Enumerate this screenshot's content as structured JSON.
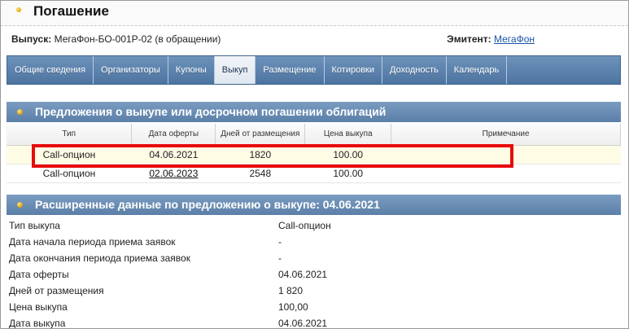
{
  "header": {
    "title": "Погашение"
  },
  "issue": {
    "label": "Выпуск:",
    "name": "МегаФон-БО-001Р-02 (в обращении)",
    "issuer_label": "Эмитент:",
    "issuer_link": "МегаФон"
  },
  "tabs": [
    {
      "label": "Общие сведения"
    },
    {
      "label": "Организаторы"
    },
    {
      "label": "Купоны"
    },
    {
      "label": "Выкуп"
    },
    {
      "label": "Размещение"
    },
    {
      "label": "Котировки"
    },
    {
      "label": "Доходность"
    },
    {
      "label": "Календарь"
    }
  ],
  "active_tab": "Выкуп",
  "offers": {
    "title": "Предложения о выкупе или досрочном погашении облигаций",
    "columns": {
      "type": "Тип",
      "date": "Дата оферты",
      "days": "Дней от размещения",
      "price": "Цена выкупа",
      "note": "Примечание"
    },
    "rows": [
      {
        "type": "Call-опцион",
        "date": "04.06.2021",
        "days": "1820",
        "price": "100.00",
        "note": ""
      },
      {
        "type": "Call-опцион",
        "date": "02.06.2023",
        "days": "2548",
        "price": "100.00",
        "note": ""
      }
    ]
  },
  "details": {
    "title": "Расширенные данные по предложению о выкупе: 04.06.2021",
    "rows": [
      {
        "k": "Тип выкупа",
        "v": "Call-опцион"
      },
      {
        "k": "Дата начала периода приема заявок",
        "v": "-"
      },
      {
        "k": "Дата окончания периода приема заявок",
        "v": "-"
      },
      {
        "k": "Дата оферты",
        "v": "04.06.2021"
      },
      {
        "k": "Дней от размещения",
        "v": "1 820"
      },
      {
        "k": "Цена выкупа",
        "v": "100,00"
      },
      {
        "k": "Дата выкупа",
        "v": "04.06.2021"
      }
    ]
  },
  "colors": {
    "tab_bar": "#5a80aa",
    "section_bar": "#6a8db5",
    "highlight": "#e8090a",
    "row_highlight": "#fffce6",
    "link": "#1a55a8"
  }
}
